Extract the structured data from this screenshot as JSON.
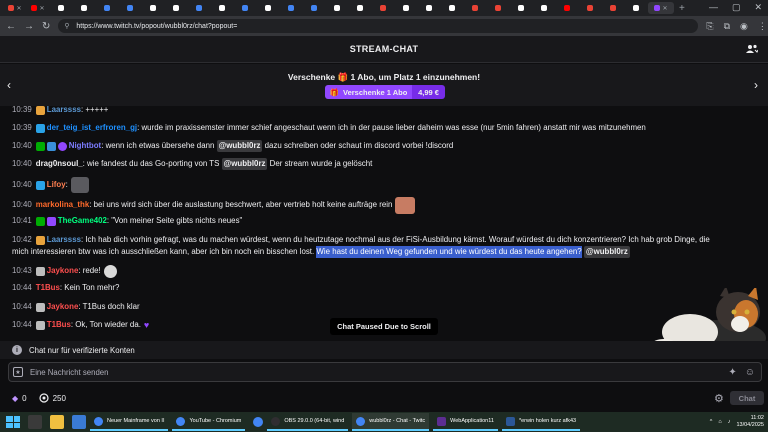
{
  "browser": {
    "url": "https://www.twitch.tv/popout/wubbl0rz/chat?popout=",
    "tabs": [
      "",
      "",
      "",
      "",
      "",
      "",
      "",
      "",
      "",
      "",
      "",
      "",
      "",
      "",
      "",
      "",
      "",
      "",
      "",
      "",
      "",
      "",
      "",
      "",
      "",
      "",
      "",
      "",
      ""
    ]
  },
  "header": {
    "title": "STREAM-CHAT"
  },
  "gift": {
    "title_pre": "Verschenke",
    "title_post": "1 Abo, um Platz 1 einzunehmen!",
    "button_label": "Verschenke 1 Abo",
    "price": "4,99 €"
  },
  "messages": [
    {
      "ts": "10:39",
      "user": "Laarssss",
      "color": "#5c99d4",
      "text": ": +++++"
    },
    {
      "ts": "10:39",
      "user": "der_teig_ist_erfroren_gj",
      "color": "#1e90ff",
      "text": ": wurde im praxissemster immer schief angeschaut wenn ich in der pause lieber daheim was esse (nur 5min fahren) anstatt mir was mitzunehmen"
    },
    {
      "ts": "10:40",
      "user": "Nightbot",
      "color": "#7c7cff",
      "text": ": wenn ich etwas übersehe dann",
      "mention": "@wubbl0rz",
      "text2": "dazu schreiben oder schaut im discord vorbei !discord"
    },
    {
      "ts": "10:40",
      "user": "drag0nsoul_",
      "color": "#efeff1",
      "text": ": wie fandest du das Go-porting von TS",
      "mention": "@wubbl0rz",
      "text2": "Der stream wurde ja gelöscht"
    },
    {
      "ts": "10:40",
      "user": "Lifoy",
      "color": "#ff7f50",
      "text": ":"
    },
    {
      "ts": "10:40",
      "user": "markolina_thk",
      "color": "#ff6a2b",
      "text": ": bei uns wird sich über die auslastung beschwert, aber vertrieb holt keine aufträge rein"
    },
    {
      "ts": "10:41",
      "user": "TheGame402",
      "color": "#00ff7f",
      "text": ": \"Von meiner Seite gibts nichts neues\""
    },
    {
      "ts": "10:42",
      "user": "Laarssss",
      "color": "#5c99d4",
      "text": ": Ich hab dich vorhin gefragt, was du machen würdest, wenn du heutzutage nochmal aus der FiSi-Ausbildung kämst. Worauf würdest du dich konzentrieren? Ich hab grob Dinge, die",
      "line2": "mich interessieren btw was ich ausschließen kann, aber ich bin noch ein bisschen lost.",
      "selected": "Wie hast du deinen Weg gefunden und wie würdest du das heute angehen?",
      "mention": "@wubbl0rz"
    },
    {
      "ts": "10:43",
      "user": "Jaykone",
      "color": "#ff4f4f",
      "text": ": rede!"
    },
    {
      "ts": "10:44",
      "user": "T1Bus",
      "color": "#ff4f4f",
      "text": ": Kein Ton mehr?"
    },
    {
      "ts": "10:44",
      "user": "Jaykone",
      "color": "#ff4f4f",
      "text": ": T1Bus doch klar"
    },
    {
      "ts": "10:44",
      "user": "T1Bus",
      "color": "#ff4f4f",
      "text": ": Ok, Ton wieder da."
    }
  ],
  "paused_label": "Chat Paused Due to Scroll",
  "verified_notice": "Chat nur für verifizierte Konten",
  "input": {
    "placeholder": "Eine Nachricht senden"
  },
  "bits": "0",
  "points": "250",
  "chat_button": "Chat",
  "taskbar": {
    "items": [
      "Neuer Mainframe von II",
      "YouTube - Chromium",
      "OBS 29.0.0 (64-bit, wind",
      "wubbl0rz - Chat - Twitc",
      "WebApplication11",
      "*erwin holen kurz afk43"
    ],
    "time": "11:02",
    "date": "13/04/2025"
  }
}
